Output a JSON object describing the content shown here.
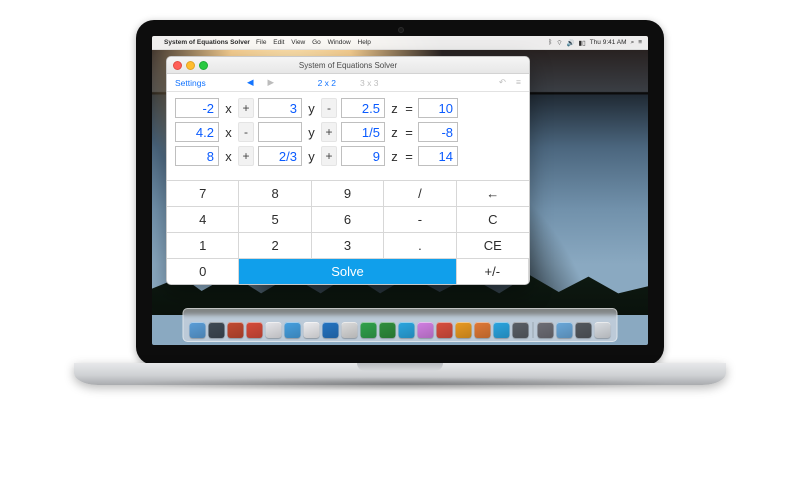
{
  "mac_menubar": {
    "apple": "",
    "app_name": "System of Equations Solver",
    "menus": [
      "File",
      "Edit",
      "View",
      "Go",
      "Window",
      "Help"
    ],
    "status": {
      "wifi": "⌃",
      "bt": "⌥",
      "vol": "◀︎",
      "batt": "▮▮"
    },
    "clock": "Thu 9:41 AM",
    "search": "⌕",
    "notif": "≡"
  },
  "window": {
    "title": "System of Equations Solver",
    "settings_label": "Settings",
    "nav_back": "◀",
    "nav_fwd": "▶",
    "mode_2x2": "2 x 2",
    "mode_3x3": "3 x 3",
    "undo": "↶",
    "menu": "≡"
  },
  "equations": [
    {
      "a": "-2",
      "op1": "+",
      "b": "3",
      "op2": "-",
      "c": "2.5",
      "rhs": "10"
    },
    {
      "a": "4.2",
      "op1": "-",
      "b": "",
      "op2": "+",
      "c": "1/5",
      "rhs": "-8"
    },
    {
      "a": "8",
      "op1": "+",
      "b": "2/3",
      "op2": "+",
      "c": "9",
      "rhs": "14"
    }
  ],
  "vars": {
    "x": "x",
    "y": "y",
    "z": "z",
    "eq": "="
  },
  "focused_field": "equations.2.rhs",
  "keypad": {
    "r1": [
      "7",
      "8",
      "9",
      "/",
      "←"
    ],
    "r2": [
      "4",
      "5",
      "6",
      "-",
      "C"
    ],
    "r3": [
      "1",
      "2",
      "3",
      ".",
      "CE"
    ],
    "r4_zero": "0",
    "r4_solve": "Solve",
    "r4_pm": "+/-"
  },
  "dock_colors": [
    "#5b9ed8",
    "#3f4a55",
    "#c24a31",
    "#d64b3a",
    "#e6e6ea",
    "#46a0e0",
    "#ededf0",
    "#2474c2",
    "#dcdcdc",
    "#31a24c",
    "#2f8f3d",
    "#2aa6e0",
    "#d17fe2",
    "#d94e3e",
    "#e99a21",
    "#e07936",
    "#2aa5e0",
    "#5a5f66",
    "#6e6e76",
    "#6aa8da",
    "#54595f",
    "#d9dde2"
  ]
}
